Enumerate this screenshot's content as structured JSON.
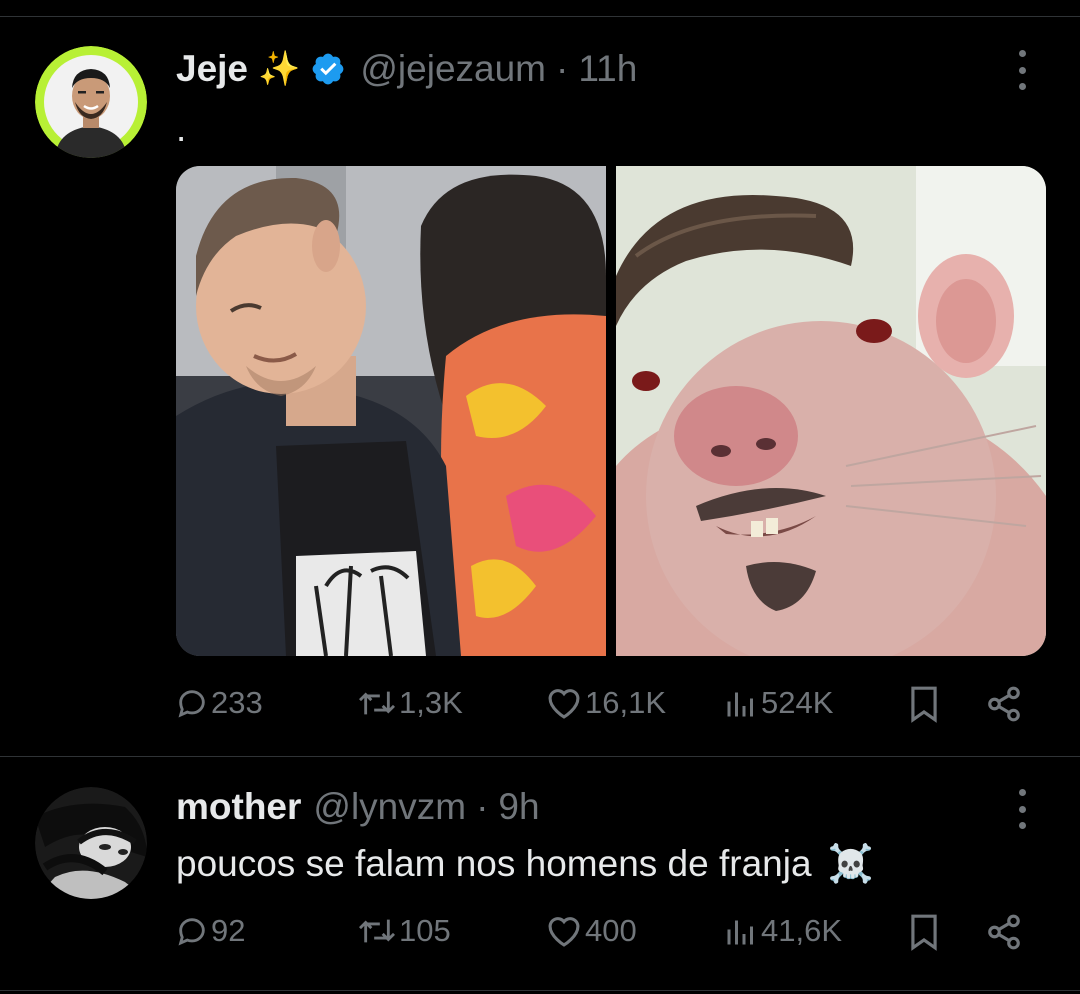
{
  "tweet1": {
    "display_name": "Jeje",
    "name_emoji": "✨",
    "handle": "@jejezaum",
    "separator": "·",
    "time": "11h",
    "text": ".",
    "stats": {
      "replies": "233",
      "retweets": "1,3K",
      "likes": "16,1K",
      "views": "524K"
    }
  },
  "tweet2": {
    "display_name": "mother",
    "handle": "@lynvzm",
    "separator": "·",
    "time": "9h",
    "text": "poucos se falam nos homens de franja",
    "text_emoji": "☠️",
    "stats": {
      "replies": "92",
      "retweets": "105",
      "likes": "400",
      "views": "41,6K"
    }
  },
  "icons": {
    "verified": "verified-badge-icon",
    "more": "more-options-icon",
    "reply": "reply-icon",
    "retweet": "retweet-icon",
    "like": "heart-icon",
    "views": "views-icon",
    "bookmark": "bookmark-icon",
    "share": "share-icon"
  },
  "colors": {
    "background": "#000000",
    "text": "#e7e9ea",
    "muted": "#71767b",
    "verified": "#1d9bf0",
    "divider": "#2f3336",
    "avatar_ring": "#b8f035"
  }
}
